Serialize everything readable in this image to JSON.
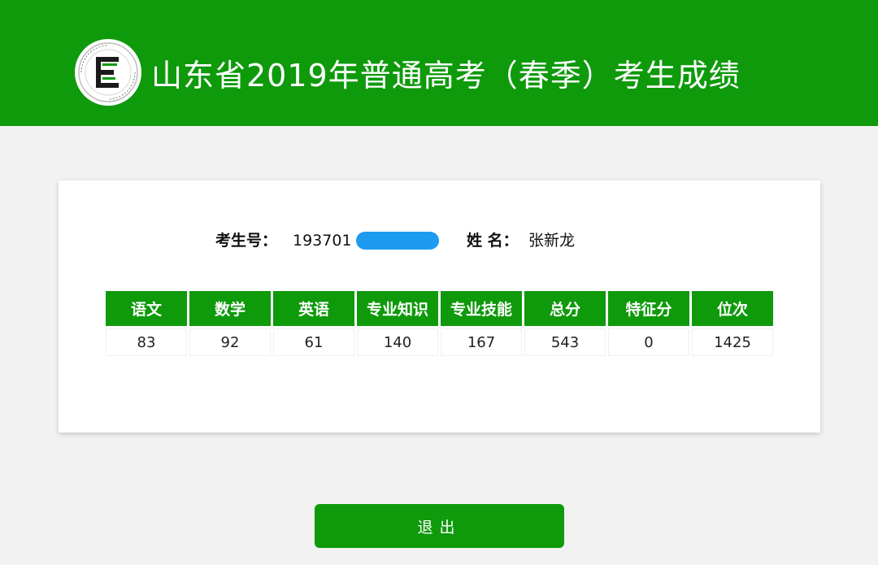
{
  "header": {
    "title": "山东省2019年普通高考（春季）考生成绩",
    "logo_letter": "E",
    "brand_color": "#0f9a0c"
  },
  "student": {
    "id_label": "考生号：",
    "id_value": "193701",
    "id_mask_color": "#1d9bf0",
    "name_label": "姓 名：",
    "name_value": "张新龙"
  },
  "scores": {
    "headers": [
      "语文",
      "数学",
      "英语",
      "专业知识",
      "专业技能",
      "总分",
      "特征分",
      "位次"
    ],
    "values": [
      "83",
      "92",
      "61",
      "140",
      "167",
      "543",
      "0",
      "1425"
    ]
  },
  "actions": {
    "logout_label": "退出"
  }
}
